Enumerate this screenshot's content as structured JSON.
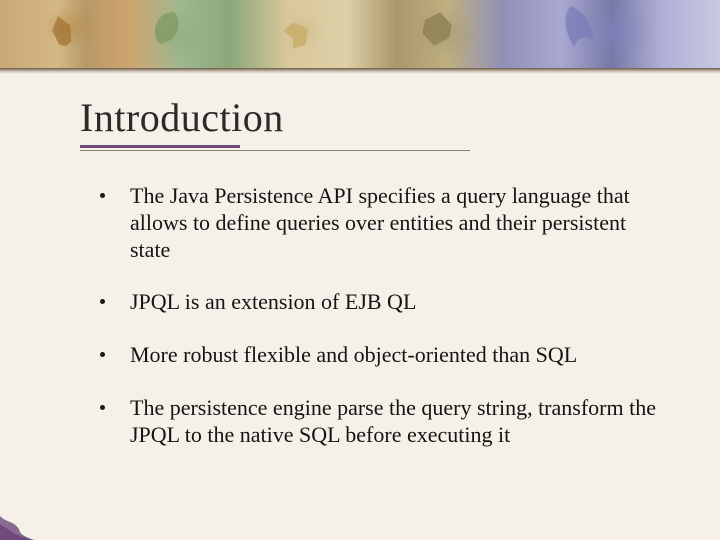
{
  "title": "Introduction",
  "bullets": [
    "The Java Persistence API specifies a query language that allows to define queries over entities and their persistent state",
    "JPQL is an extension of EJB QL",
    "More robust flexible and object-oriented than SQL",
    "The persistence engine parse the query string, transform the JPQL to the native SQL before executing it"
  ],
  "accent_color": "#6f4a7a",
  "background_color": "#f5f0e8"
}
